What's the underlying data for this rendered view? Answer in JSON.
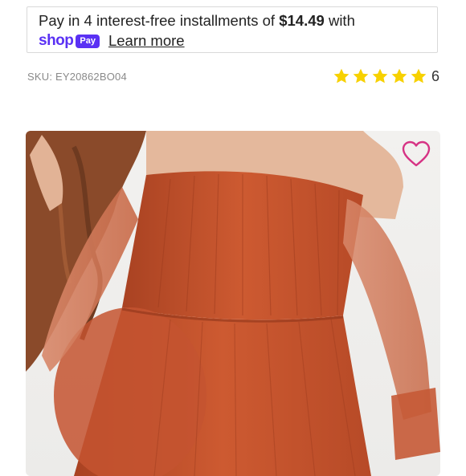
{
  "shoppay": {
    "text_before": "Pay in 4 interest-free installments of ",
    "amount": "$14.49",
    "text_after": " with",
    "brand_word": "shop",
    "brand_pill": "Pay",
    "learn_more": "Learn more",
    "brand_color": "#5a31f4"
  },
  "product": {
    "sku": "SKU: EY20862BO04",
    "rating_stars": 5,
    "rating_count": "6",
    "star_color": "#f7d100",
    "dress_color": "#c6542e",
    "favorite_icon": "heart-outline-icon",
    "favorite_color": "#d63384"
  }
}
